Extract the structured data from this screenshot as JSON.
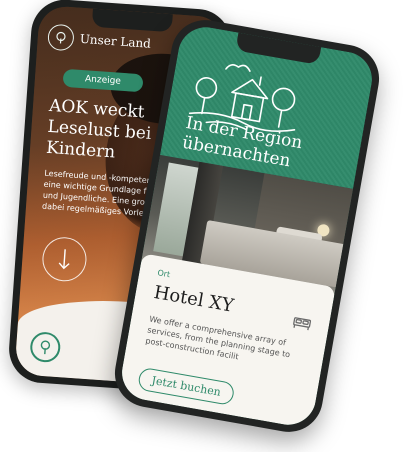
{
  "phone_left": {
    "brand": "Unser Land",
    "badge": "Anzeige",
    "headline": "AOK weckt Leselust bei Kindern",
    "body": "Lesefreude und -kompetenz sind eine wichtige Grundlage für Kinder und Jugendliche. Eine große Hilfe ist dabei regelmäßiges Vorlesen.",
    "icons": {
      "logo": "tree-logo-icon",
      "menu": "hamburger-menu-icon",
      "scroll": "arrow-down-icon"
    },
    "colors": {
      "accent_green": "#2f8a6a",
      "menu_red": "#e55a4e"
    }
  },
  "phone_right": {
    "headline": "In der Region übernachten",
    "card": {
      "tag": "Ort",
      "title": "Hotel XY",
      "description": "We offer a comprehensive array of services, from the planning stage to post-construction facilit",
      "cta": "Jetzt buchen"
    },
    "icons": {
      "illustration": "village-houses-illustration",
      "bed": "bed-icon"
    },
    "colors": {
      "background_green": "#2f8a6a",
      "card_bg": "#f7f5f0"
    }
  }
}
